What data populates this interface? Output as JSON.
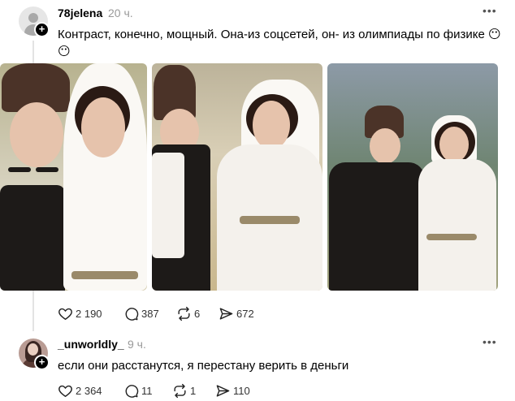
{
  "post": {
    "username": "78jelena",
    "time": "20 ч.",
    "text": "Контраст, конечно, мощный. Она-из соцсетей, он- из олимпиады по физике 😶😶",
    "more_label": "•••",
    "avatar_icon": "default-user-avatar",
    "actions": {
      "likes": "2 190",
      "comments": "387",
      "reposts": "6",
      "shares": "672"
    }
  },
  "reply": {
    "username": "_unworldly_",
    "time": "9 ч.",
    "text": "если они расстанутся, я перестану верить в деньги",
    "more_label": "•••",
    "actions": {
      "likes": "2 364",
      "comments": "11",
      "reposts": "1",
      "shares": "110"
    }
  },
  "plus_label": "+",
  "colors": {
    "text": "#000000",
    "muted": "#999999",
    "thread_line": "#e3e3e3"
  }
}
